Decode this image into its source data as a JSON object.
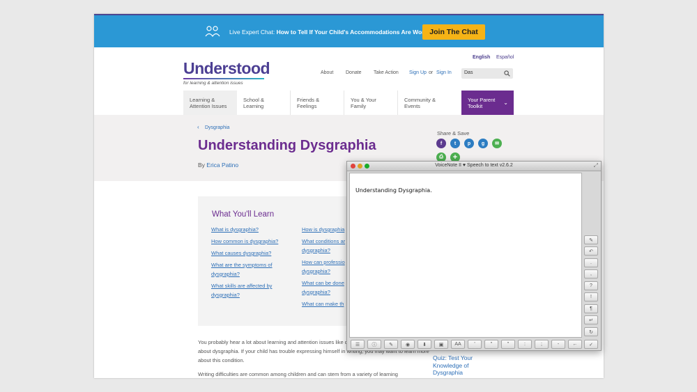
{
  "banner": {
    "prefix": "Live Expert Chat:",
    "headline": "How to Tell If Your Child's Accommodations Are Working",
    "join_label": "Join The Chat",
    "bg_color": "#2b98d5",
    "button_color": "#f5b316"
  },
  "header": {
    "lang_en": "English",
    "lang_es": "Español",
    "logo": "Understood",
    "tagline": "for learning & attention issues",
    "about": "About",
    "donate": "Donate",
    "take_action": "Take Action",
    "sign_up": "Sign Up",
    "or": "or",
    "sign_in": "Sign In",
    "search_value": "Das"
  },
  "nav": {
    "items": [
      {
        "line1": "Learning &",
        "line2": "Attention Issues"
      },
      {
        "line1": "School &",
        "line2": "Learning"
      },
      {
        "line1": "Friends &",
        "line2": "Feelings"
      },
      {
        "line1": "You & Your",
        "line2": "Family"
      },
      {
        "line1": "Community &",
        "line2": "Events"
      }
    ],
    "toolkit": {
      "line1": "Your Parent",
      "line2": "Toolkit"
    },
    "toolkit_color": "#6b2c8f"
  },
  "article": {
    "breadcrumb": "Dysgraphia",
    "title": "Understanding Dysgraphia",
    "by": "By",
    "author": "Erica Patino",
    "share_label": "Share & Save"
  },
  "share_icons": [
    "facebook-icon",
    "twitter-icon",
    "pinterest-icon",
    "googleplus-icon",
    "email-icon",
    "print-icon",
    "add-icon"
  ],
  "learn": {
    "title": "What You'll Learn",
    "col1": [
      "What is dysgraphia?",
      "How common is dysgraphia?",
      "What causes dysgraphia?",
      "What are the symptoms of dysgraphia?",
      "What skills are affected by dysgraphia?"
    ],
    "col2": [
      "How is dysgraphia",
      "What conditions ar dysgraphia?",
      "How can professio dysgraphia?",
      "What can be done dysgraphia?",
      "What can make th"
    ]
  },
  "body": {
    "p1": "You probably hear a lot about learning and attention issues like d chances are you don't hear much about dysgraphia. If your child has trouble expressing himself in writing, you may want to learn more about this condition.",
    "p2": "Writing difficulties are common among children and can stem from a variety of learning",
    "quiz": "Quiz: Test Your Knowledge of Dysgraphia"
  },
  "voicenote": {
    "title": "VoiceNote II ♥ Speech to text v2.6.2",
    "content": "Understanding Dysgraphia.",
    "side_buttons": [
      "✎",
      "↶",
      ".",
      ",",
      "?",
      "!",
      "¶",
      "↵",
      "↻"
    ],
    "bottom_buttons": [
      "☰",
      "ⓘ",
      "✎",
      "◉",
      "⬇",
      "▣",
      "AA",
      "'",
      "\"",
      "\"",
      ":",
      ";",
      "-",
      "←",
      "✓"
    ]
  }
}
